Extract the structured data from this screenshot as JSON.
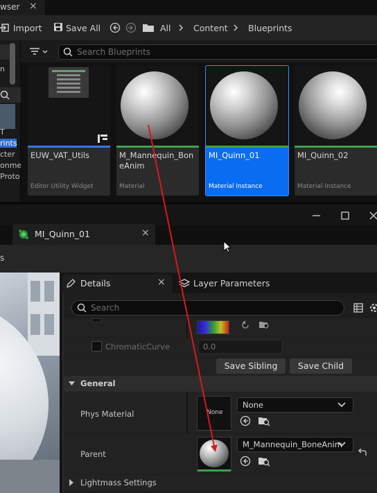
{
  "content_browser": {
    "tab_label": "wser",
    "toolbar": {
      "import_label": "Import",
      "save_all_label": "Save All",
      "breadcrumbs": [
        "All",
        "Content",
        "Blueprints"
      ]
    },
    "search_placeholder": "Search Blueprints",
    "left_panel_fragments": [
      "n",
      "T",
      "rints",
      "cter",
      "onme",
      "Proto"
    ],
    "assets": [
      {
        "name": "EUW_VAT_Utils",
        "type": "Editor Utility Widget",
        "accent": "#2d7ce0"
      },
      {
        "name": "M_Mannequin_BoneAnim",
        "type": "Material",
        "accent": "#3aa548"
      },
      {
        "name": "MI_Quinn_01",
        "type": "Material Instance",
        "accent": "#3aa548",
        "selected": true
      },
      {
        "name": "MI_Quinn_02",
        "type": "Material Instance",
        "accent": "#3aa548"
      }
    ]
  },
  "material_editor": {
    "document_tab_label": "MI_Quinn_01",
    "toolbar_fragment": "s",
    "tabs": {
      "details": "Details",
      "layer_parameters": "Layer Parameters"
    },
    "search_placeholder": "Search",
    "curve_row": {
      "label": "ChromaticCurve",
      "value": "0.0"
    },
    "buttons": {
      "save_sibling": "Save Sibling",
      "save_child": "Save Child"
    },
    "general": {
      "header": "General",
      "phys_material": {
        "label": "Phys Material",
        "thumb_text": "None",
        "value": "None"
      },
      "parent": {
        "label": "Parent",
        "value": "M_Mannequin_BoneAnim"
      }
    },
    "lightmass_header": "Lightmass Settings"
  },
  "annotation": {
    "arrow_color": "#d81a1a"
  }
}
